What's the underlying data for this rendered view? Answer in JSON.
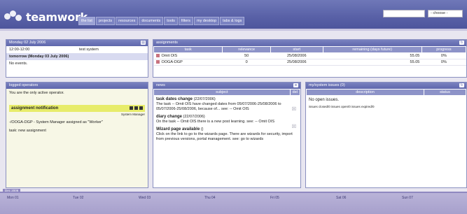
{
  "header": {
    "logo_text": "teamwork",
    "nav": [
      "the list",
      "projects",
      "resources",
      "documents",
      "tools",
      "filters",
      "my desktop",
      "tabs & logs"
    ],
    "select_value": "- choose -"
  },
  "date_panel": {
    "title": "Monday 02 July 2006",
    "rows": [
      {
        "time": "12:00-12:00",
        "text": "test system"
      },
      {
        "time": "tomorrow (Monday 03 July 2006)",
        "text": ""
      },
      {
        "time": "No events.",
        "text": ""
      }
    ]
  },
  "assignments": {
    "title": "assignments",
    "columns": [
      "task",
      "relevance",
      "start",
      "remaining (days future)",
      "progress"
    ],
    "rows": [
      {
        "task": "Omit OIS",
        "relevance": "50",
        "start": "25/08/2006",
        "remaining": "55.05",
        "progress": "0%"
      },
      {
        "task": "OOGA-DGP",
        "relevance": "0",
        "start": "25/08/2006",
        "remaining": "55.05",
        "progress": "0%"
      }
    ]
  },
  "operators": {
    "title": "logged operators",
    "line1": "You are the only active operator.",
    "notification_title": "assignment notification",
    "role": "System Manager",
    "detail": "-/OOGA-DGP - System Manager assigned as \"Worker\"",
    "task": "task: new assignment"
  },
  "news": {
    "title": "news",
    "column": "subject",
    "items": [
      {
        "title": "task dates change",
        "meta": "(22/07/2006)",
        "body": "The task -- Omit OIS have changed dates from 05/07/2006-25/08/2006 to 05/07/2006-25/08/2006, because of... see: -- Omit OIS"
      },
      {
        "title": "diary change",
        "meta": "(22/07/2006)",
        "body": "On the task -- Omit OIS there is a new post learning. see: -- Omit OIS"
      },
      {
        "title": "Wizard page available",
        "meta": "()",
        "body": "Click on the link to go to the wizards page. There are wizards for security, import from previous versions, portal management. see: go to wizards"
      }
    ]
  },
  "issues": {
    "title": "my/system issues (0)",
    "columns": [
      "description",
      "status"
    ],
    "empty_text": "No open issues.",
    "footer_text": "issues closed/0 issues open/0 issues expired/0"
  },
  "calendar": {
    "tag": "Dec 2006",
    "days": [
      "Mon 01",
      "Tue 02",
      "Wed 03",
      "Thu 04",
      "Fri 05",
      "Sat 06",
      "Sun 07"
    ]
  },
  "colors": {
    "header": "#5a62a8",
    "accent": "#8d93c8",
    "highlight": "#e7ec6a"
  }
}
